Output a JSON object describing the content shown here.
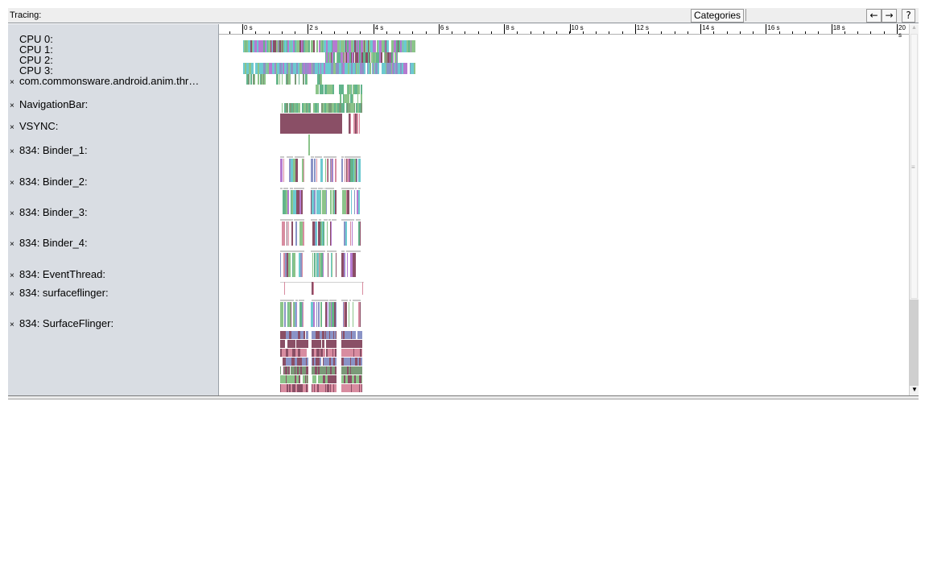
{
  "toolbar": {
    "title": "Tracing:",
    "categories_label": "Categories",
    "nav_back_label": "←",
    "nav_forward_label": "→",
    "help_label": "?"
  },
  "ruler": {
    "labels": [
      "0 s",
      "2 s",
      "4 s",
      "6 s",
      "8 s",
      "10 s",
      "12 s",
      "14 s",
      "16 s",
      "18 s",
      "20 s"
    ]
  },
  "rows": [
    {
      "label": "CPU 0:",
      "closable": false
    },
    {
      "label": "CPU 1:",
      "closable": false
    },
    {
      "label": "CPU 2:",
      "closable": false
    },
    {
      "label": "CPU 3:",
      "closable": false
    },
    {
      "label": "com.commonsware.android.anim.thr…",
      "closable": true
    },
    {
      "label": "NavigationBar:",
      "closable": true
    },
    {
      "label": "VSYNC:",
      "closable": true
    },
    {
      "label": "834: Binder_1:",
      "closable": true
    },
    {
      "label": "834: Binder_2:",
      "closable": true
    },
    {
      "label": "834: Binder_3:",
      "closable": true
    },
    {
      "label": "834: Binder_4:",
      "closable": true
    },
    {
      "label": "834: EventThread:",
      "closable": true
    },
    {
      "label": "834: surfaceflinger:",
      "closable": true
    },
    {
      "label": "834: SurfaceFlinger:",
      "closable": true
    }
  ],
  "close_glyph": "×",
  "scrollbar": {
    "up_glyph": "▲",
    "grip_glyph": "≡",
    "down_glyph": "▼"
  },
  "colors": {
    "cyan": "#6cc9d0",
    "purple": "#b57ad0",
    "green": "#8cc48a",
    "teal_green": "#62b48c",
    "maroon": "#8a4f66",
    "pink": "#d88ca0",
    "blue_gray": "#8a93c6",
    "olive": "#7a9a78"
  }
}
